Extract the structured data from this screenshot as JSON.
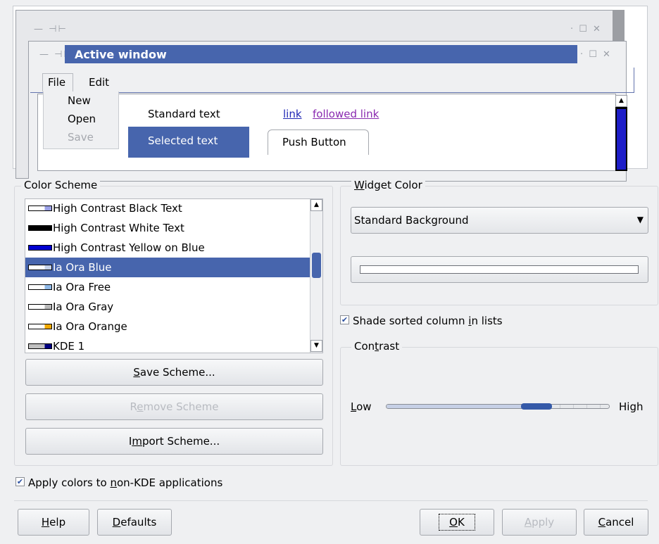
{
  "preview": {
    "active_title": "Active window",
    "menu": {
      "file": "File",
      "edit": "Edit"
    },
    "popup": {
      "new": "New",
      "open": "Open",
      "save": "Save"
    },
    "standard_text": "Standard text",
    "selected_text": "Selected text",
    "link": "link",
    "followed_link": "followed link",
    "push_button": "Push Button",
    "titlebar_left_icons": "— ⊣⊢",
    "titlebar_right_icons": "· ☐ ✕"
  },
  "color_scheme": {
    "title": "Color Scheme",
    "items": [
      {
        "label": "High Contrast Black Text",
        "swatch": [
          "#ffffff",
          "#9aa0e6"
        ]
      },
      {
        "label": "High Contrast White Text",
        "swatch": [
          "#000000",
          "#000000"
        ]
      },
      {
        "label": "High Contrast Yellow on Blue",
        "swatch": [
          "#0000d0",
          "#0000d0"
        ]
      },
      {
        "label": "Ia Ora Blue",
        "swatch": [
          "#ffffff",
          "#c4d0e8"
        ],
        "selected": true
      },
      {
        "label": "Ia Ora Free",
        "swatch": [
          "#ffffff",
          "#8fb8e6"
        ]
      },
      {
        "label": "Ia Ora Gray",
        "swatch": [
          "#ffffff",
          "#b8b8b8"
        ]
      },
      {
        "label": "Ia Ora Orange",
        "swatch": [
          "#ffffff",
          "#f0a800"
        ]
      },
      {
        "label": "KDE 1",
        "swatch": [
          "#c0c0c0",
          "#000080"
        ]
      }
    ],
    "save_button": {
      "pre": "",
      "accel": "S",
      "post": "ave Scheme..."
    },
    "remove_button": {
      "pre": "R",
      "accel": "e",
      "post": "move Scheme"
    },
    "import_button": {
      "pre": "I",
      "accel": "m",
      "post": "port Scheme..."
    }
  },
  "widget_color": {
    "title": {
      "accel": "W",
      "post": "idget Color"
    },
    "selected_value": "Standard Background",
    "current_color": "#ffffff"
  },
  "shade_sorted": {
    "pre": "Shade sorted column ",
    "accel": "i",
    "post": "n lists",
    "checked": true
  },
  "contrast": {
    "title": {
      "pre": "Con",
      "accel": "t",
      "post": "rast"
    },
    "low": {
      "accel": "L",
      "post": "ow"
    },
    "high": "High",
    "level_fraction": 0.71
  },
  "apply_non_kde": {
    "pre": "Apply colors to ",
    "accel": "n",
    "post": "on-KDE applications",
    "checked": true
  },
  "buttons": {
    "help": {
      "accel": "H",
      "post": "elp"
    },
    "defaults": {
      "accel": "D",
      "post": "efaults"
    },
    "ok": {
      "accel": "O",
      "post": "K"
    },
    "apply": {
      "accel": "A",
      "post": "pply"
    },
    "cancel": {
      "accel": "C",
      "post": "ancel"
    }
  },
  "colors": {
    "selection": "#4765ad",
    "link": "#2229b5",
    "visited": "#8a2ab0"
  }
}
